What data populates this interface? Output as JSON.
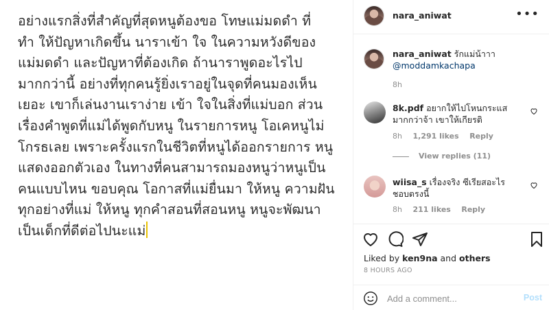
{
  "post": {
    "text_lines": [
      "อย่างแรกสิ่งที่สำคัญที่สุดหนูต้องขอ โทษแม่มดดำ ที่",
      "ทำ ให้ปัญหาเกิดขึ้น นาราเข้า ใจ ในความหวังดีของ",
      "แม่มดดำ และปัญหาที่ต้องเกิด ถ้านาราพูดอะไรไป",
      "มากกว่านี้ อย่างที่ทุกคนรู้ยิ่งเราอยู่ในจุดที่คนมองเห็น",
      "เยอะ เขาก็เล่นงานเราง่าย เข้า ใจในสิ่งที่แม่บอก ส่วน",
      "เรื่องคำพูดที่แม่ได้พูดกับหนู ในรายการหนู โอเคหนูไม่",
      "โกรธเลย เพราะครั้งแรกในชีวิตที่หนูได้ออกรายการ หนู",
      "แสดงออกตัวเอง ในทางที่คนสามารถมองหนูว่าหนูเป็น",
      "คนแบบไหน ขอบคุณ โอกาสที่แม่ยื่นมา ให้หนู ความฝัน",
      "ทุกอย่างที่แม่ ให้หนู ทุกคำสอนที่สอนหนู หนูจะพัฒนา",
      "เป็นเด็กที่ดีต่อไปนะแม่"
    ]
  },
  "header": {
    "username": "nara_aniwat",
    "more_label": "•••"
  },
  "caption": {
    "username": "nara_aniwat",
    "text": " รักแม่น้าาา",
    "mention": "@moddamkachapa",
    "time": "8h"
  },
  "comments": [
    {
      "username": "8k.pdf",
      "text": " อยากให้ไปโหนกระแส มากกว่าจ้า เขาให้เกียรติ",
      "time": "8h",
      "likes": "1,291 likes",
      "reply": "Reply",
      "view_replies": "View replies (11)"
    },
    {
      "username": "wiisa_s",
      "text": " เรื่องจริง ซีเรียสอะไร ชอบตรงนี้",
      "time": "8h",
      "likes": "211 likes",
      "reply": "Reply"
    }
  ],
  "actions": {
    "liked_by_prefix": "Liked by ",
    "liked_by_user": "ken9na",
    "liked_by_suffix": " and ",
    "liked_by_others": "others",
    "time_ago": "8 HOURS AGO"
  },
  "add_comment": {
    "placeholder": "Add a comment...",
    "post_label": "Post"
  },
  "icons": {
    "like": "heart-icon",
    "comment": "comment-icon",
    "share": "share-icon",
    "save": "bookmark-icon",
    "emoji": "emoji-icon"
  },
  "colors": {
    "mention": "#00376b",
    "post_disabled": "#b2dffc",
    "meta_gray": "#8e8e8e"
  }
}
